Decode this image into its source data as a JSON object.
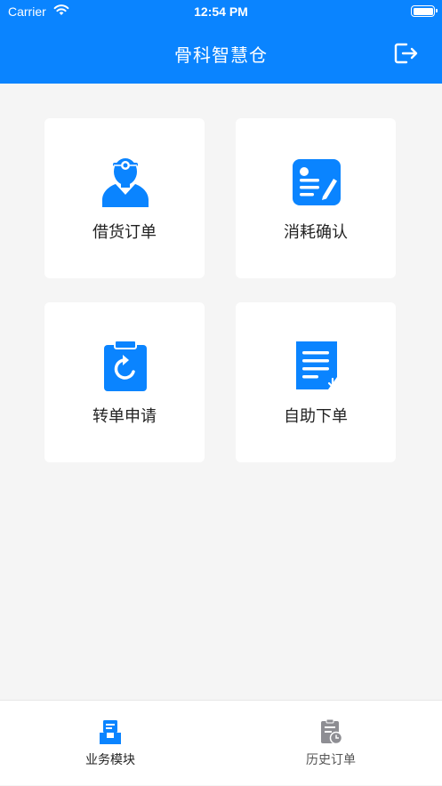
{
  "status_bar": {
    "carrier": "Carrier",
    "time": "12:54 PM"
  },
  "header": {
    "title": "骨科智慧仓"
  },
  "modules": [
    {
      "label": "借货订单",
      "icon": "doctor-icon"
    },
    {
      "label": "消耗确认",
      "icon": "id-card-edit-icon"
    },
    {
      "label": "转单申请",
      "icon": "clipboard-refresh-icon"
    },
    {
      "label": "自助下单",
      "icon": "document-download-icon"
    }
  ],
  "tabbar": {
    "tabs": [
      {
        "label": "业务模块",
        "active": true
      },
      {
        "label": "历史订单",
        "active": false
      }
    ]
  },
  "colors": {
    "primary": "#0a84ff",
    "background": "#f5f5f5",
    "tab_inactive": "#8e8e93"
  }
}
